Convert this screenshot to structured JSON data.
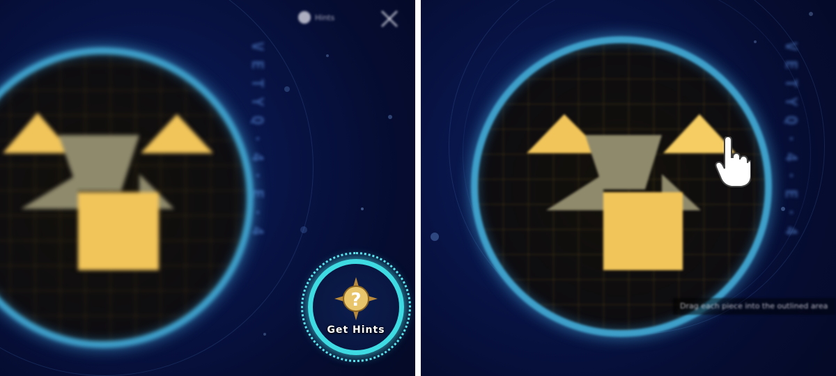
{
  "left_panel": {
    "top_hint_label": "Hints",
    "hint_button_label": "Get Hints",
    "rune_text": "V E T Y Q · 4 · E · 4"
  },
  "right_panel": {
    "caption": "Drag each piece into the outlined area",
    "rune_text": "V E T Y Q · 4 · E · 4"
  },
  "icons": {
    "hint": "question-mark-compass-icon",
    "close": "close-icon",
    "pointer": "pointing-hand-icon"
  },
  "colors": {
    "background": "#081446",
    "ring": "#3e9fc9",
    "piece_gold": "#f2c55a",
    "piece_gray": "#8f8a6c",
    "hint_ring": "#3fdbe3"
  }
}
